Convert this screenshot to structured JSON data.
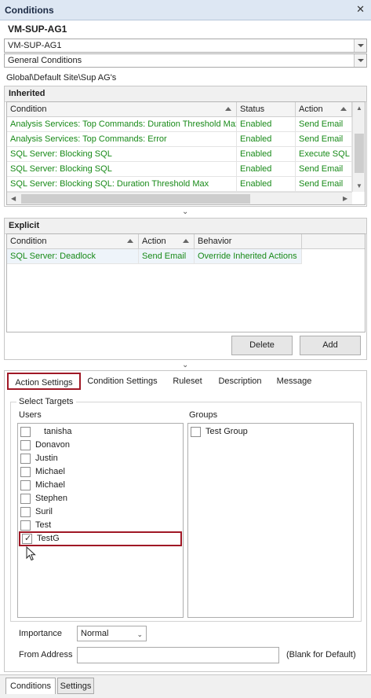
{
  "window": {
    "title": "Conditions",
    "close_glyph": "✕"
  },
  "server_name": "VM-SUP-AG1",
  "server_combo": {
    "value": "VM-SUP-AG1"
  },
  "condition_type_combo": {
    "value": "General Conditions"
  },
  "path": "Global\\Default Site\\Sup AG's",
  "inherited": {
    "title": "Inherited",
    "columns": [
      "Condition",
      "Status",
      "Action"
    ],
    "rows": [
      [
        "Analysis Services: Top Commands: Duration Threshold Max",
        "Enabled",
        "Send Email"
      ],
      [
        "Analysis Services: Top Commands: Error",
        "Enabled",
        "Send Email"
      ],
      [
        "SQL Server: Blocking SQL",
        "Enabled",
        "Execute SQL"
      ],
      [
        "SQL Server: Blocking SQL",
        "Enabled",
        "Send Email"
      ],
      [
        "SQL Server: Blocking SQL: Duration Threshold Max",
        "Enabled",
        "Send Email"
      ]
    ]
  },
  "explicit": {
    "title": "Explicit",
    "columns": [
      "Condition",
      "Action",
      "Behavior"
    ],
    "rows": [
      [
        "SQL Server: Deadlock",
        "Send Email",
        "Override Inherited Actions"
      ]
    ],
    "delete_label": "Delete",
    "add_label": "Add"
  },
  "tabs": [
    "Action Settings",
    "Condition Settings",
    "Ruleset",
    "Description",
    "Message"
  ],
  "active_tab": "Action Settings",
  "select_targets": {
    "title": "Select Targets",
    "users_label": "Users",
    "groups_label": "Groups",
    "users": [
      {
        "name": "tanisha",
        "checked": false
      },
      {
        "name": "Donavon",
        "checked": false
      },
      {
        "name": "Justin",
        "checked": false
      },
      {
        "name": "Michael",
        "checked": false
      },
      {
        "name": "Michael",
        "checked": false
      },
      {
        "name": "Stephen",
        "checked": false
      },
      {
        "name": "Suril",
        "checked": false
      },
      {
        "name": "Test",
        "checked": false
      },
      {
        "name": "TestG",
        "checked": true
      }
    ],
    "groups": [
      {
        "name": "Test Group",
        "checked": false
      }
    ]
  },
  "importance": {
    "label": "Importance",
    "value": "Normal"
  },
  "from_address": {
    "label": "From Address",
    "value": "",
    "hint": "(Blank for Default)"
  },
  "bottom_tabs": [
    "Conditions",
    "Settings"
  ],
  "colors": {
    "highlight": "#a01826",
    "condition_text": "#188a18",
    "title_bg": "#dde7f3"
  },
  "icons": {
    "collapse": "chevron-down-icon",
    "check": "checkmark-icon",
    "cursor": "mouse-pointer-icon"
  }
}
